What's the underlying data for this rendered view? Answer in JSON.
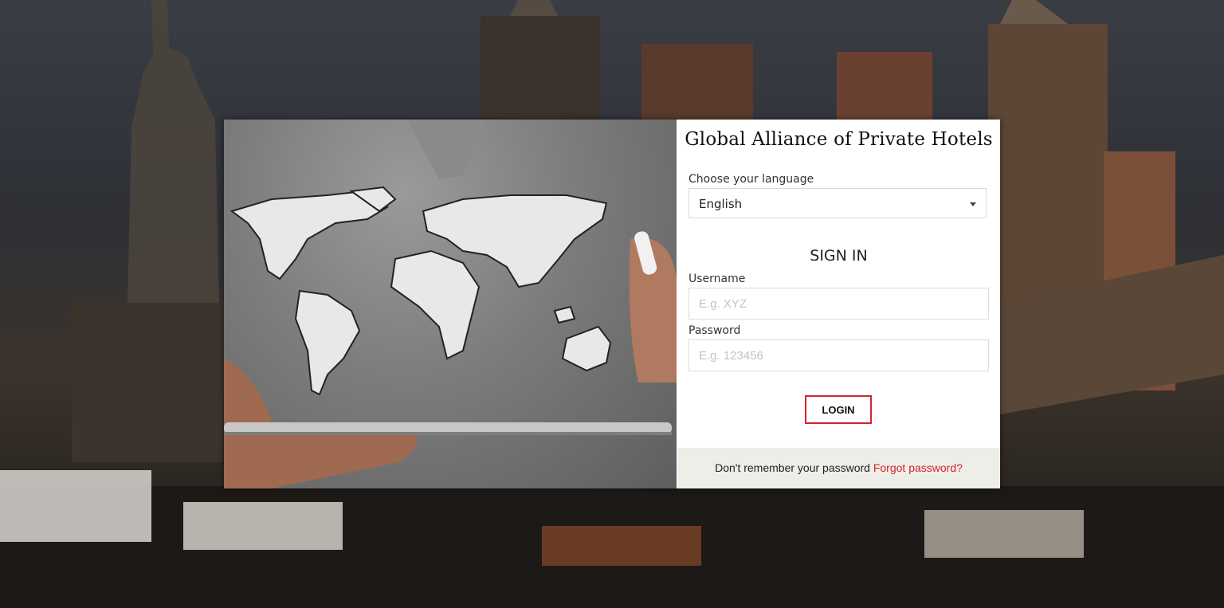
{
  "brand": {
    "title": "Global Alliance of Private Hotels"
  },
  "language": {
    "label": "Choose your language",
    "selected": "English"
  },
  "signin": {
    "heading": "SIGN IN",
    "username_label": "Username",
    "username_placeholder": "E.g. XYZ",
    "password_label": "Password",
    "password_placeholder": "E.g. 123456",
    "login_label": "LOGIN"
  },
  "footer": {
    "text": "Don't remember your password",
    "link": "Forgot password?"
  },
  "colors": {
    "accent": "#d6232a",
    "footer_bg": "#eeeee9"
  },
  "icons": {
    "language_dropdown": "caret-down-icon"
  }
}
